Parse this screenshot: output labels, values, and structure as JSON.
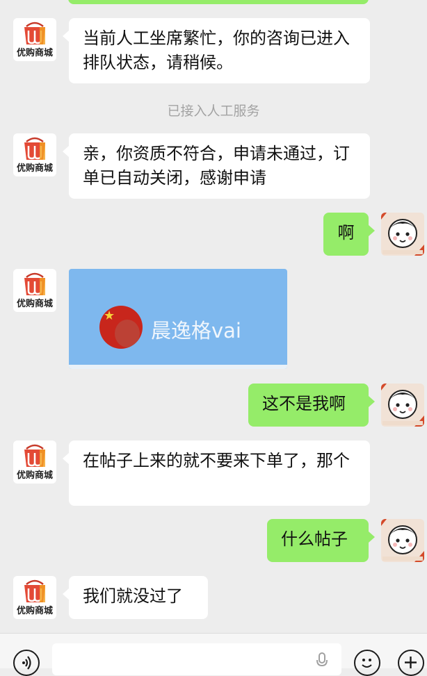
{
  "shop": {
    "logo_text": "优购商城"
  },
  "system": {
    "connected_notice": "已接入人工服务"
  },
  "messages": {
    "m1": "当前人工坐席繁忙，你的咨询已进入排队状态，请稍候。",
    "m2": "亲，你资质不符合，申请未通过，订单已自动关闭，感谢申请",
    "m3": "啊",
    "m4_card_name": "晨逸格vai",
    "m5": "这不是我啊",
    "m6": "在帖子上来的就不要来下单了，那个",
    "m7": "什么帖子",
    "m8": "我们就没过了"
  },
  "colors": {
    "chat_bg": "#ededed",
    "bubble_in": "#ffffff",
    "bubble_out": "#95ec69",
    "card_bg": "#7eb8ee",
    "system_text": "#a3a3a3"
  },
  "icons": {
    "shop_avatar": "shopping-bag-logo",
    "user_avatar": "cartoon-face",
    "voice": "voice-icon",
    "mic": "microphone-icon",
    "emoji": "emoji-icon",
    "plus": "plus-icon"
  }
}
